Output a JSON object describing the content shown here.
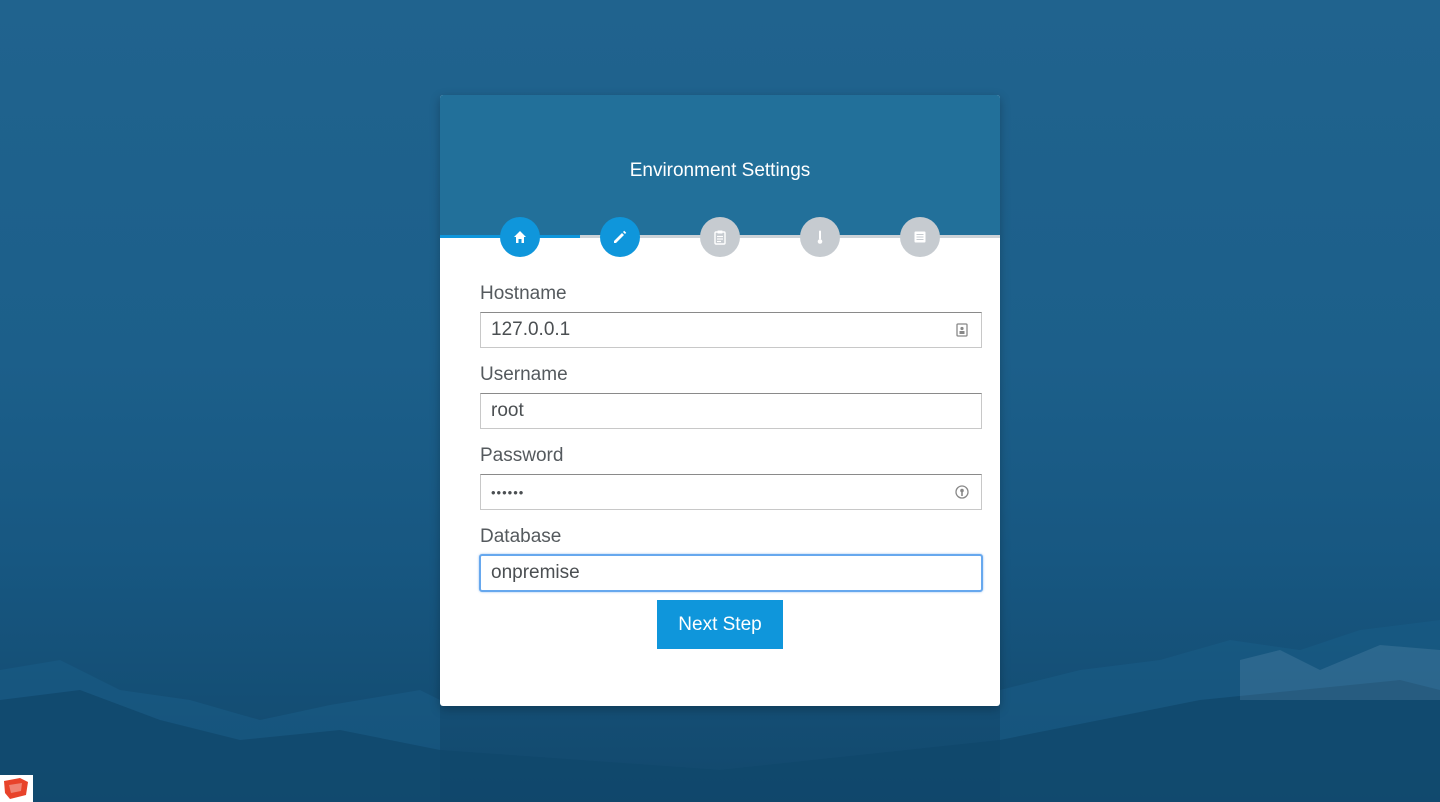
{
  "card": {
    "title": "Environment Settings"
  },
  "steps": [
    {
      "icon": "home-icon",
      "active": true
    },
    {
      "icon": "pencil-icon",
      "active": true
    },
    {
      "icon": "clipboard-icon",
      "active": false
    },
    {
      "icon": "thermometer-icon",
      "active": false
    },
    {
      "icon": "list-icon",
      "active": false
    }
  ],
  "progress": 0.25,
  "form": {
    "hostname": {
      "label": "Hostname",
      "value": "127.0.0.1"
    },
    "username": {
      "label": "Username",
      "value": "root"
    },
    "password": {
      "label": "Password",
      "value": "••••••"
    },
    "database": {
      "label": "Database",
      "value": "onpremise"
    },
    "submit_label": "Next Step"
  },
  "colors": {
    "accent": "#0f96db",
    "header": "#22709a",
    "background": "#1c5f8a",
    "inactive_step": "#c6cbd0"
  }
}
